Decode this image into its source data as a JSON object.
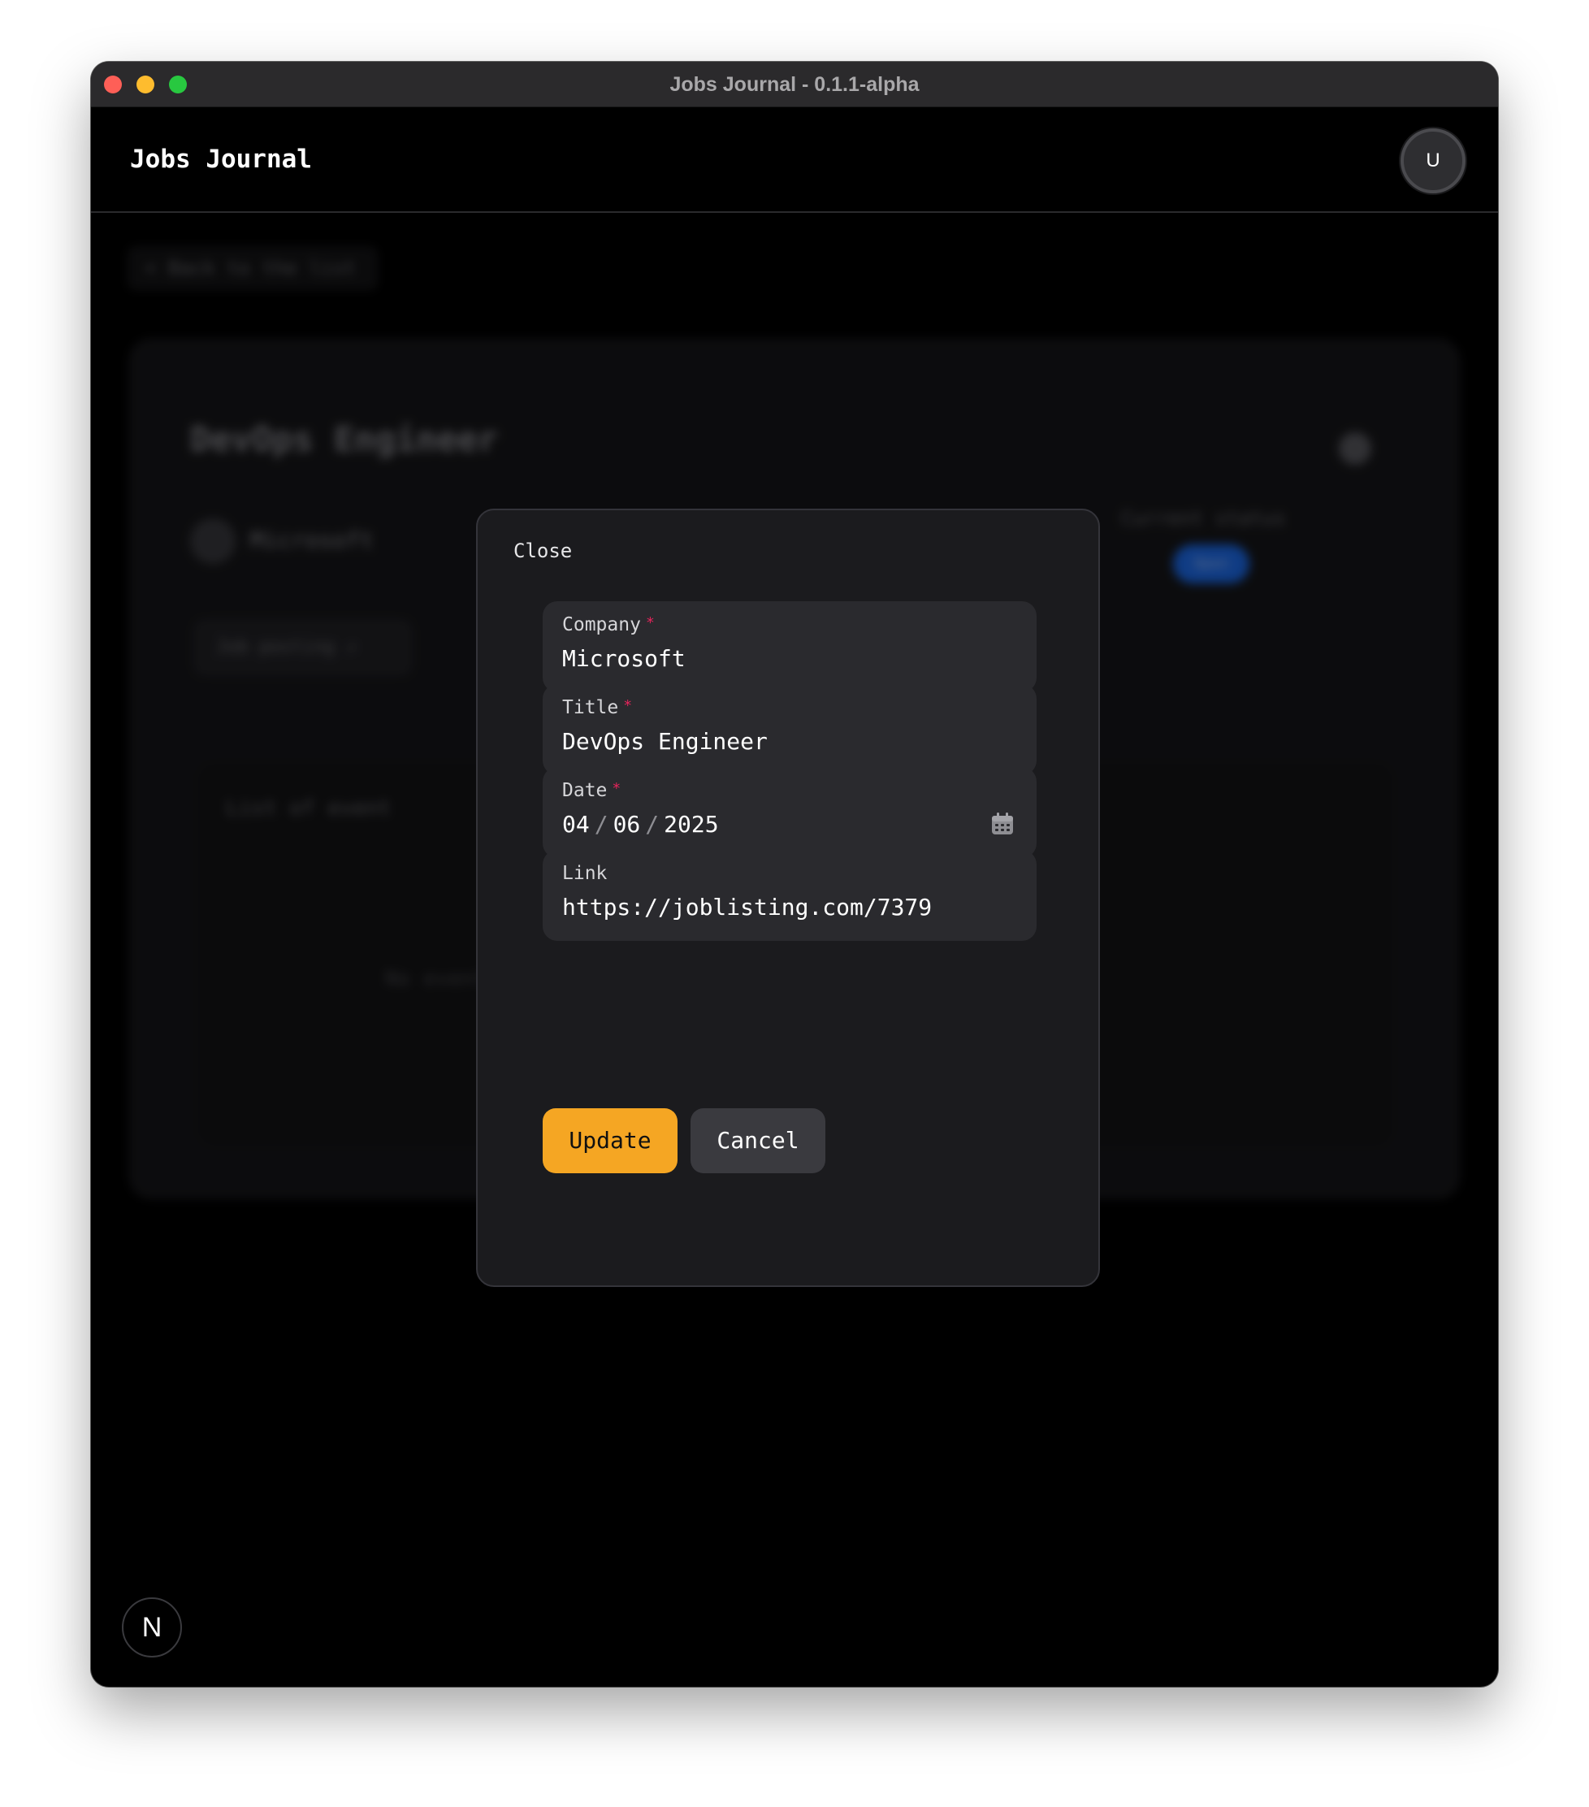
{
  "window": {
    "title": "Jobs Journal - 0.1.1-alpha"
  },
  "header": {
    "brand": "Jobs Journal",
    "avatar_initial": "U"
  },
  "background": {
    "back_label": "< Back to the list",
    "job_title": "DevOps Engineer",
    "company": "Microsoft",
    "status_label": "Current status",
    "status_value": "Open",
    "posting_label": "Job posting ↗",
    "events_title": "List of event",
    "events_empty": "No events"
  },
  "modal": {
    "close_label": "Close",
    "fields": {
      "company": {
        "label": "Company",
        "value": "Microsoft",
        "required": "*"
      },
      "title": {
        "label": "Title",
        "value": "DevOps Engineer",
        "required": "*"
      },
      "date": {
        "label": "Date",
        "month": "04",
        "day": "06",
        "year": "2025",
        "separator": "/",
        "required": "*"
      },
      "link": {
        "label": "Link",
        "value": "https://joblisting.com/7379"
      }
    },
    "buttons": {
      "update": "Update",
      "cancel": "Cancel"
    }
  },
  "dev_indicator": {
    "label": "N"
  },
  "icons": {
    "calendar": "calendar-icon"
  },
  "colors": {
    "accent": "#f5a623",
    "required": "#e5245b",
    "status_badge": "#1d6df0"
  }
}
